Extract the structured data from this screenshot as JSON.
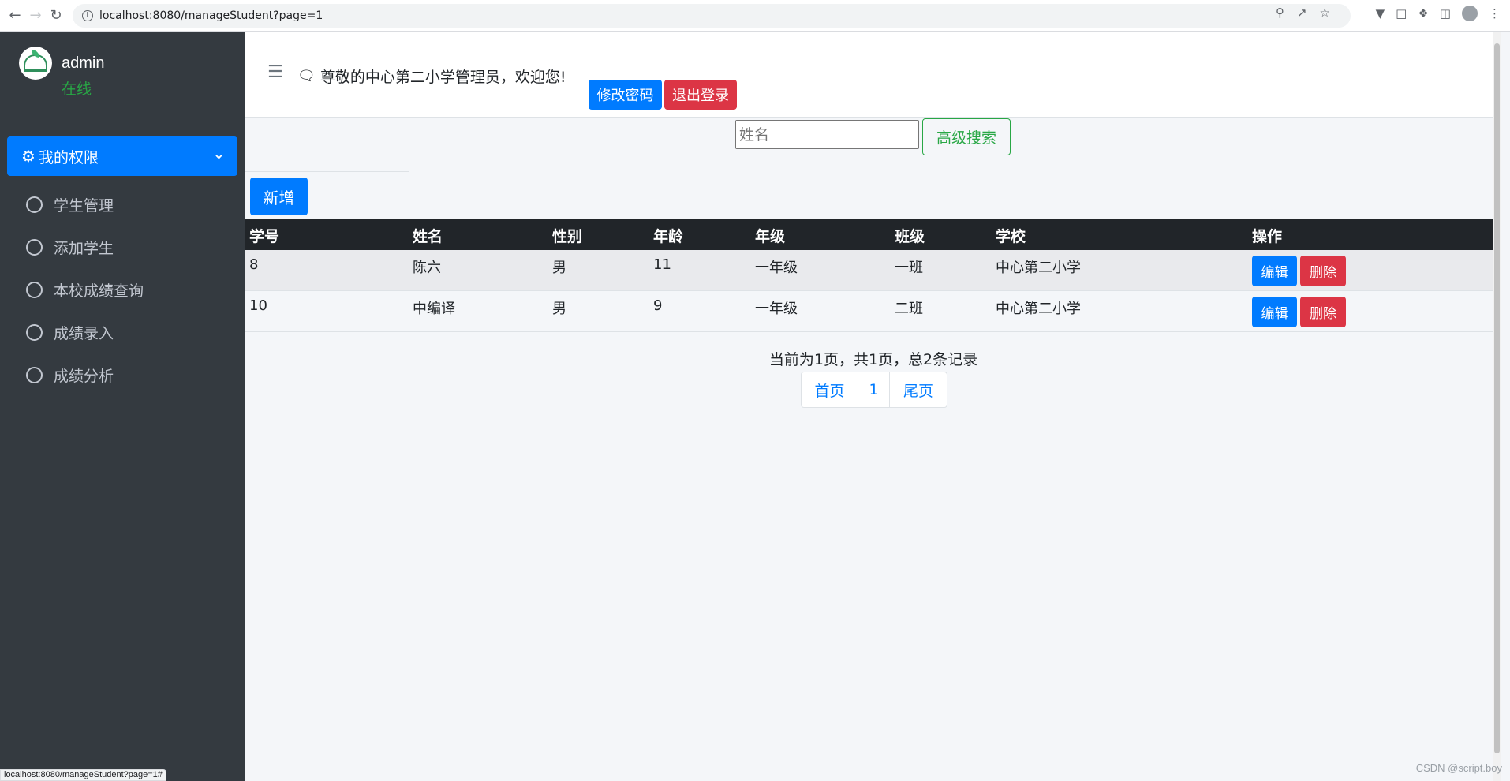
{
  "browser": {
    "url": "localhost:8080/manageStudent?page=1",
    "status_url": "localhost:8080/manageStudent?page=1#"
  },
  "sidebar": {
    "user_name": "admin",
    "user_status": "在线",
    "menu_title": "我的权限",
    "items": [
      {
        "label": "学生管理"
      },
      {
        "label": "添加学生"
      },
      {
        "label": "本校成绩查询"
      },
      {
        "label": "成绩录入"
      },
      {
        "label": "成绩分析"
      }
    ]
  },
  "header": {
    "welcome": "尊敬的中心第二小学管理员，欢迎您!",
    "change_password": "修改密码",
    "logout": "退出登录"
  },
  "search": {
    "placeholder": "姓名",
    "button": "高级搜索"
  },
  "toolbar": {
    "add_label": "新增"
  },
  "table": {
    "columns": [
      "学号",
      "姓名",
      "性别",
      "年龄",
      "年级",
      "班级",
      "学校",
      "操作"
    ],
    "rows": [
      {
        "id": "8",
        "name": "陈六",
        "gender": "男",
        "age": "11",
        "grade": "一年级",
        "class": "一班",
        "school": "中心第二小学"
      },
      {
        "id": "10",
        "name": "中编译",
        "gender": "男",
        "age": "9",
        "grade": "一年级",
        "class": "二班",
        "school": "中心第二小学"
      }
    ],
    "edit_label": "编辑",
    "delete_label": "删除"
  },
  "pagination": {
    "info": "当前为1页，共1页，总2条记录",
    "first": "首页",
    "current": "1",
    "last": "尾页"
  },
  "watermark": "CSDN @script.boy",
  "colors": {
    "primary": "#007bff",
    "danger": "#dc3545",
    "success": "#28a745",
    "sidebar_bg": "#343a40",
    "table_head": "#212529"
  }
}
